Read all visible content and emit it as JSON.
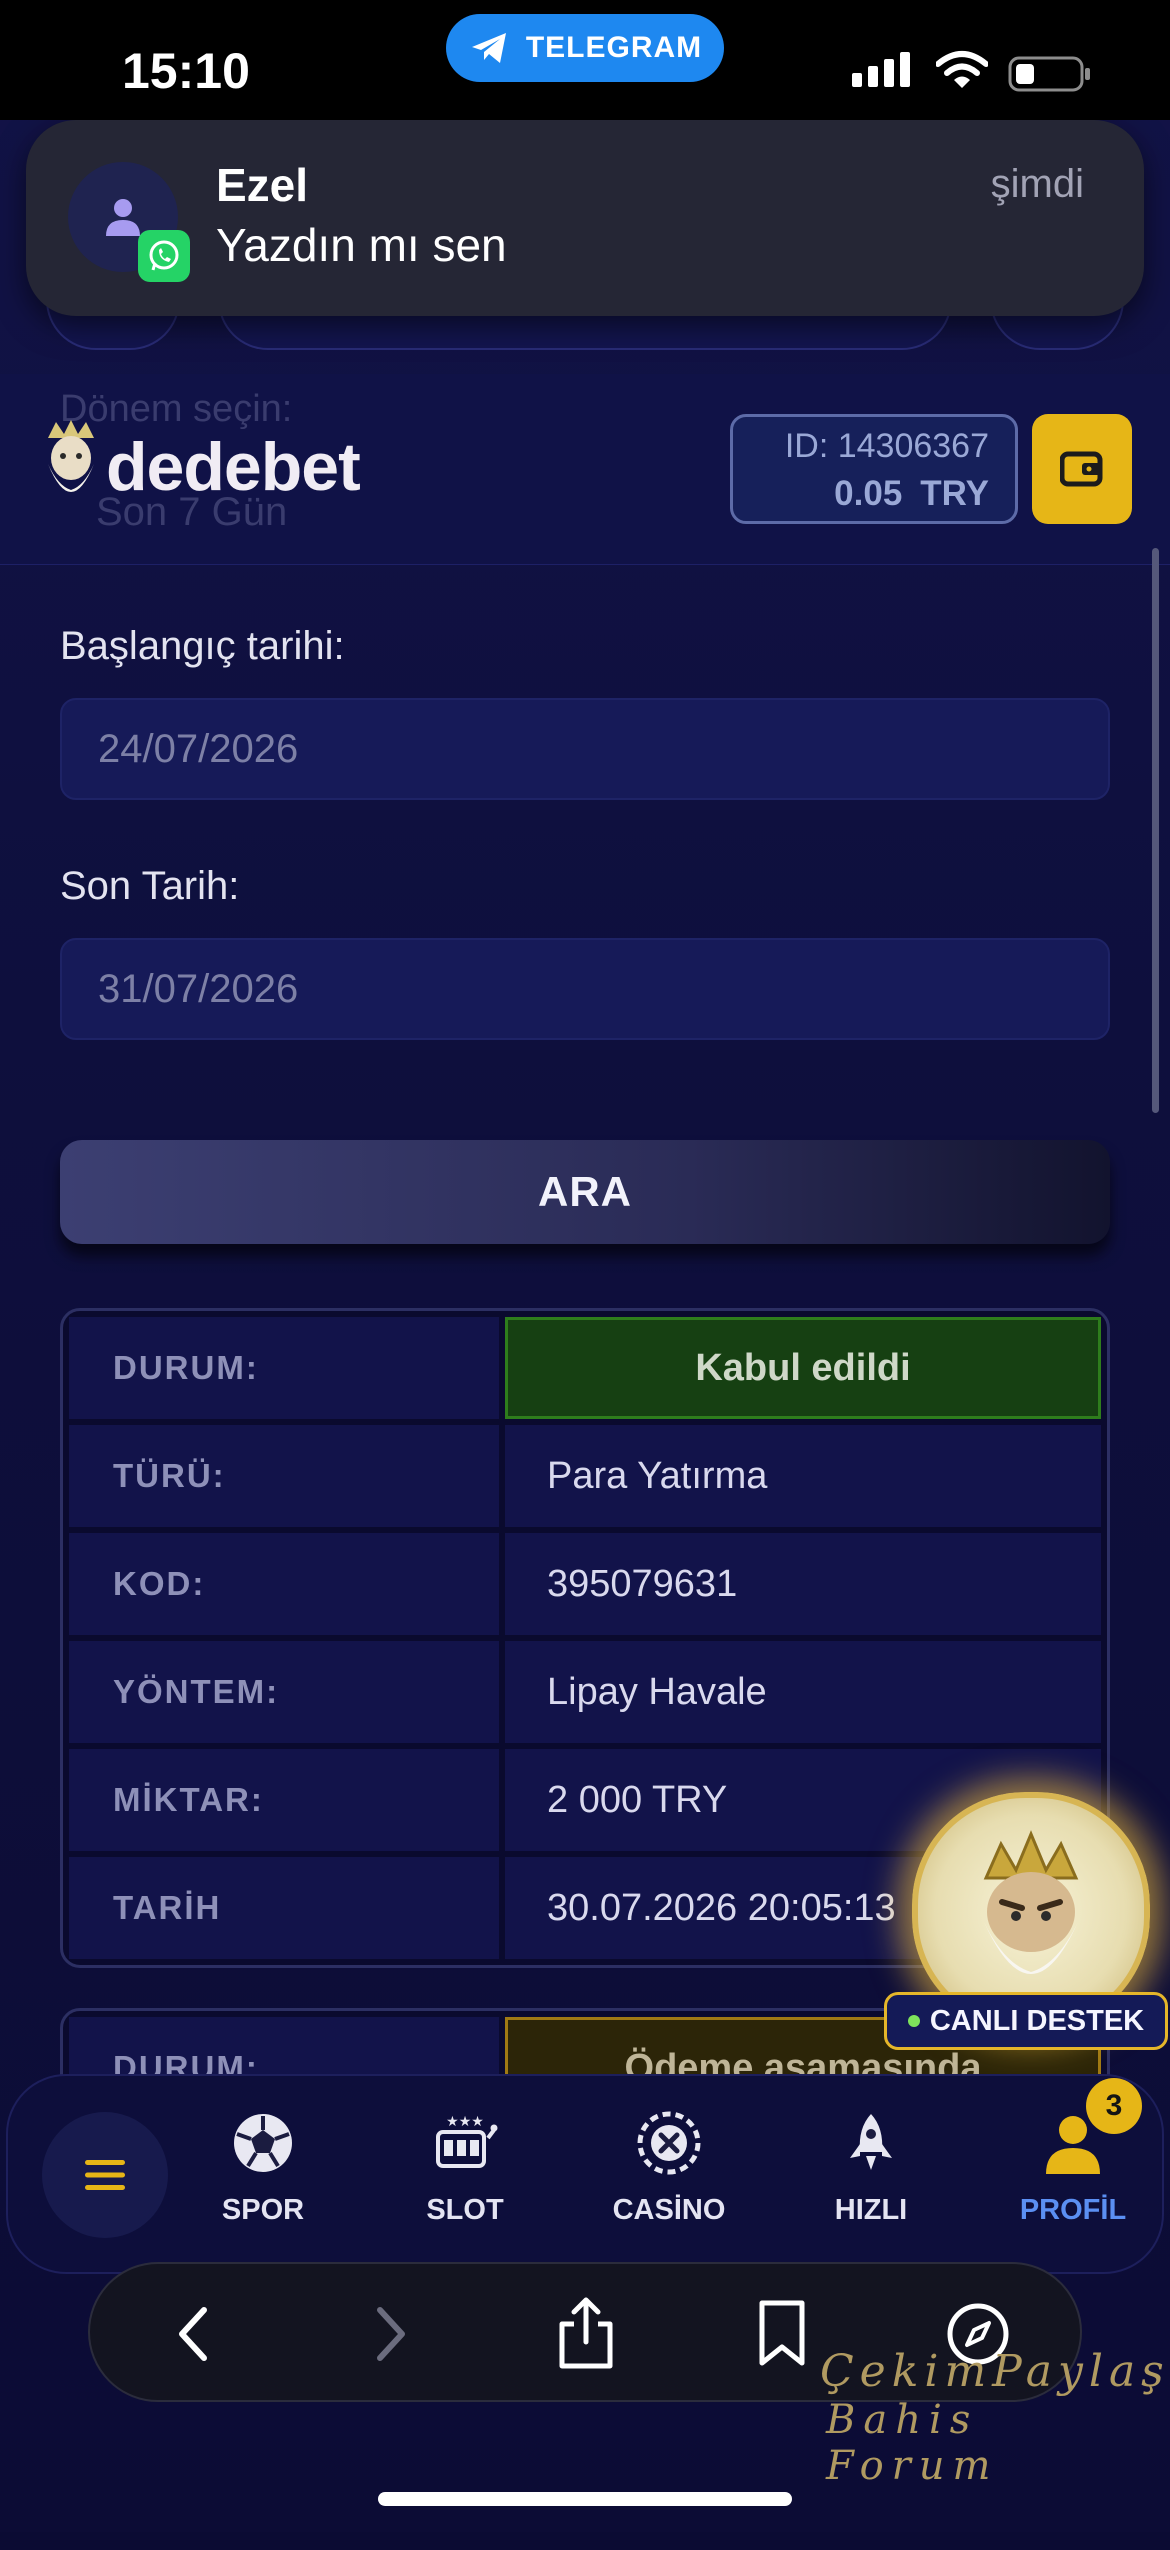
{
  "status_bar": {
    "time": "15:10",
    "telegram_label": "TELEGRAM"
  },
  "notification": {
    "sender": "Ezel",
    "message": "Yazdın mı sen",
    "time": "şimdi",
    "app_icon": "whatsapp-icon"
  },
  "header": {
    "ghost_label": "Dönem seçin:",
    "ghost_value": "Son 7 Gün",
    "logo_text": "dedebet",
    "account_id": "ID: 14306367",
    "balance": "0.05",
    "currency": "TRY",
    "wallet_icon": "wallet-icon"
  },
  "form": {
    "start_label": "Başlangıç tarihi:",
    "start_value": "24/07/2026",
    "end_label": "Son Tarih:",
    "end_value": "31/07/2026",
    "search_button": "ARA"
  },
  "transactions": [
    {
      "rows": [
        {
          "key": "DURUM:",
          "value": "Kabul edildi"
        },
        {
          "key": "TÜRÜ:",
          "value": "Para Yatırma"
        },
        {
          "key": "KOD:",
          "value": "395079631"
        },
        {
          "key": "YÖNTEM:",
          "value": "Lipay Havale"
        },
        {
          "key": "MİKTAR:",
          "value": "2 000 TRY"
        },
        {
          "key": "TARİH",
          "value": "30.07.2026 20:05:13"
        }
      ]
    },
    {
      "rows": [
        {
          "key": "DURUM:",
          "value": "Ödeme aşamasında"
        }
      ]
    }
  ],
  "support": {
    "label": "CANLI DESTEK"
  },
  "bottom_nav": {
    "items": [
      {
        "label": "SPOR",
        "icon": "soccer-ball-icon"
      },
      {
        "label": "SLOT",
        "icon": "slot-machine-icon"
      },
      {
        "label": "CASİNO",
        "icon": "roulette-chip-icon"
      },
      {
        "label": "HIZLI",
        "icon": "rocket-icon"
      },
      {
        "label": "PROFİL",
        "icon": "user-icon"
      }
    ],
    "profile_badge": "3",
    "active": "PROFİL"
  },
  "browser": {
    "icons": [
      "back-icon",
      "forward-icon",
      "share-icon",
      "bookmarks-icon",
      "compass-icon"
    ]
  },
  "watermark": {
    "line1": "ÇekimPaylaş",
    "line2": "Bahis Forum"
  },
  "colors": {
    "accent_gold": "#e6b617",
    "active_blue": "#5b8ff2",
    "success_green": "#2e7d1c",
    "pending_gold": "#a07a14"
  }
}
